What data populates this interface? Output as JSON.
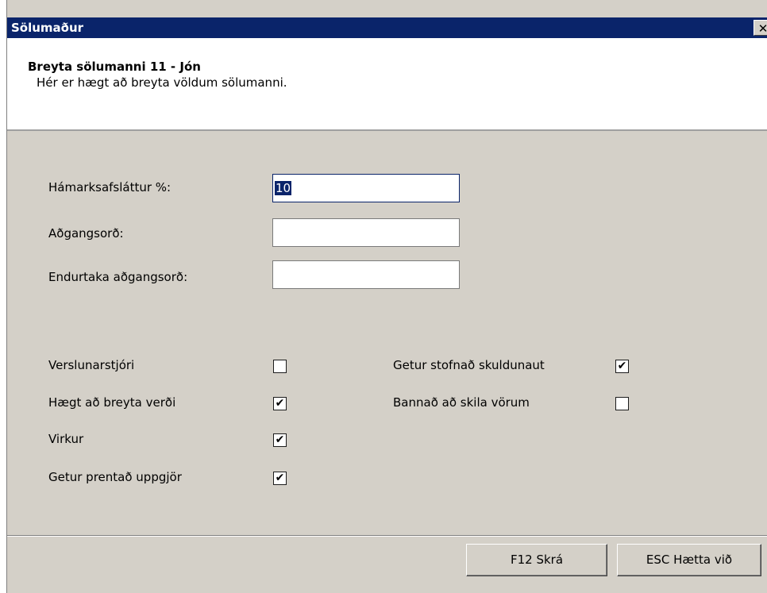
{
  "window": {
    "title": "Sölumaður",
    "close_glyph": "✕",
    "close_icon": "close-icon"
  },
  "header": {
    "title": "Breyta sölumanni 11 - Jón",
    "subtitle": "Hér er hægt að breyta völdum sölumanni."
  },
  "fields": {
    "discount": {
      "label": "Hámarksafsláttur %:",
      "value": "10"
    },
    "password": {
      "label": "Aðgangsorð:",
      "value": ""
    },
    "password_repeat": {
      "label": "Endurtaka aðgangsorð:",
      "value": ""
    }
  },
  "checkboxes": {
    "store_manager": {
      "label": "Verslunarstjóri",
      "checked": false
    },
    "can_change_price": {
      "label": "Hægt að breyta verði",
      "checked": true
    },
    "active": {
      "label": "Virkur",
      "checked": true
    },
    "can_print_settlement": {
      "label": "Getur prentað uppgjör",
      "checked": true
    },
    "can_create_debtor": {
      "label": "Getur stofnað skuldunaut",
      "checked": true
    },
    "no_returns": {
      "label": "Bannað að skila vörum",
      "checked": false
    }
  },
  "buttons": {
    "save": "F12  Skrá",
    "cancel": "ESC  Hætta við"
  },
  "colors": {
    "titlebar": "#0a246a",
    "face": "#d4d0c8"
  }
}
